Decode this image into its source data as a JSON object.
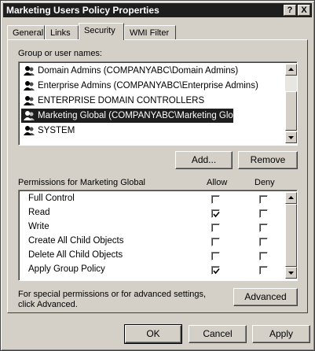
{
  "window": {
    "title": "Marketing Users Policy Properties",
    "help_glyph": "?",
    "close_glyph": "X"
  },
  "tabs": [
    {
      "label": "General"
    },
    {
      "label": "Links"
    },
    {
      "label": "Security",
      "active": true
    },
    {
      "label": "WMI Filter"
    }
  ],
  "group_label": "Group or user names:",
  "groups": [
    {
      "name": "Domain Admins (COMPANYABC\\Domain Admins)",
      "selected": false
    },
    {
      "name": "Enterprise Admins (COMPANYABC\\Enterprise Admins)",
      "selected": false
    },
    {
      "name": "ENTERPRISE DOMAIN CONTROLLERS",
      "selected": false
    },
    {
      "name": "Marketing Global (COMPANYABC\\Marketing Global)",
      "selected": true
    },
    {
      "name": "SYSTEM",
      "selected": false
    }
  ],
  "add_label": "Add...",
  "remove_label": "Remove",
  "permissions": {
    "header": "Permissions for Marketing Global",
    "allow_header": "Allow",
    "deny_header": "Deny",
    "rows": [
      {
        "name": "Full Control",
        "allow": false,
        "deny": false
      },
      {
        "name": "Read",
        "allow": true,
        "deny": false
      },
      {
        "name": "Write",
        "allow": false,
        "deny": false
      },
      {
        "name": "Create All Child Objects",
        "allow": false,
        "deny": false
      },
      {
        "name": "Delete All Child Objects",
        "allow": false,
        "deny": false
      },
      {
        "name": "Apply Group Policy",
        "allow": true,
        "deny": false
      }
    ]
  },
  "advanced_text": "For special permissions or for advanced settings, click Advanced.",
  "advanced_label": "Advanced",
  "ok_label": "OK",
  "cancel_label": "Cancel",
  "apply_label": "Apply"
}
